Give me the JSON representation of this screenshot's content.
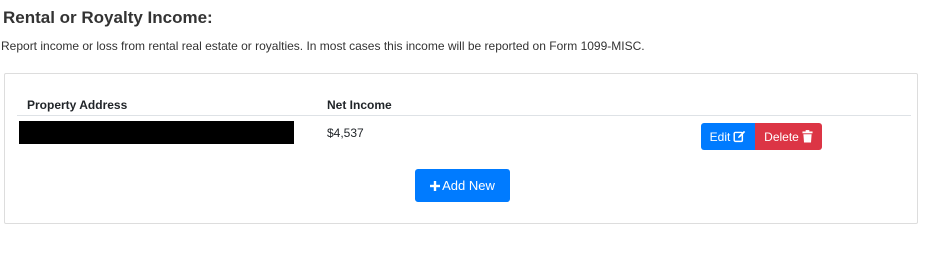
{
  "section": {
    "title": "Rental or Royalty Income:",
    "description": "Report income or loss from rental real estate or royalties. In most cases this income will be reported on Form 1099-MISC."
  },
  "table": {
    "columns": [
      "Property Address",
      "Net Income"
    ],
    "rows": [
      {
        "property_address": "",
        "net_income": "$4,537",
        "edit_label": "Edit",
        "delete_label": "Delete"
      }
    ]
  },
  "actions": {
    "add_new_label": "Add New"
  },
  "icons": {
    "edit": "edit-icon",
    "delete": "trash-icon",
    "add": "plus-icon"
  },
  "colors": {
    "primary": "#007bff",
    "danger": "#dc3545",
    "redaction": "#000000"
  }
}
